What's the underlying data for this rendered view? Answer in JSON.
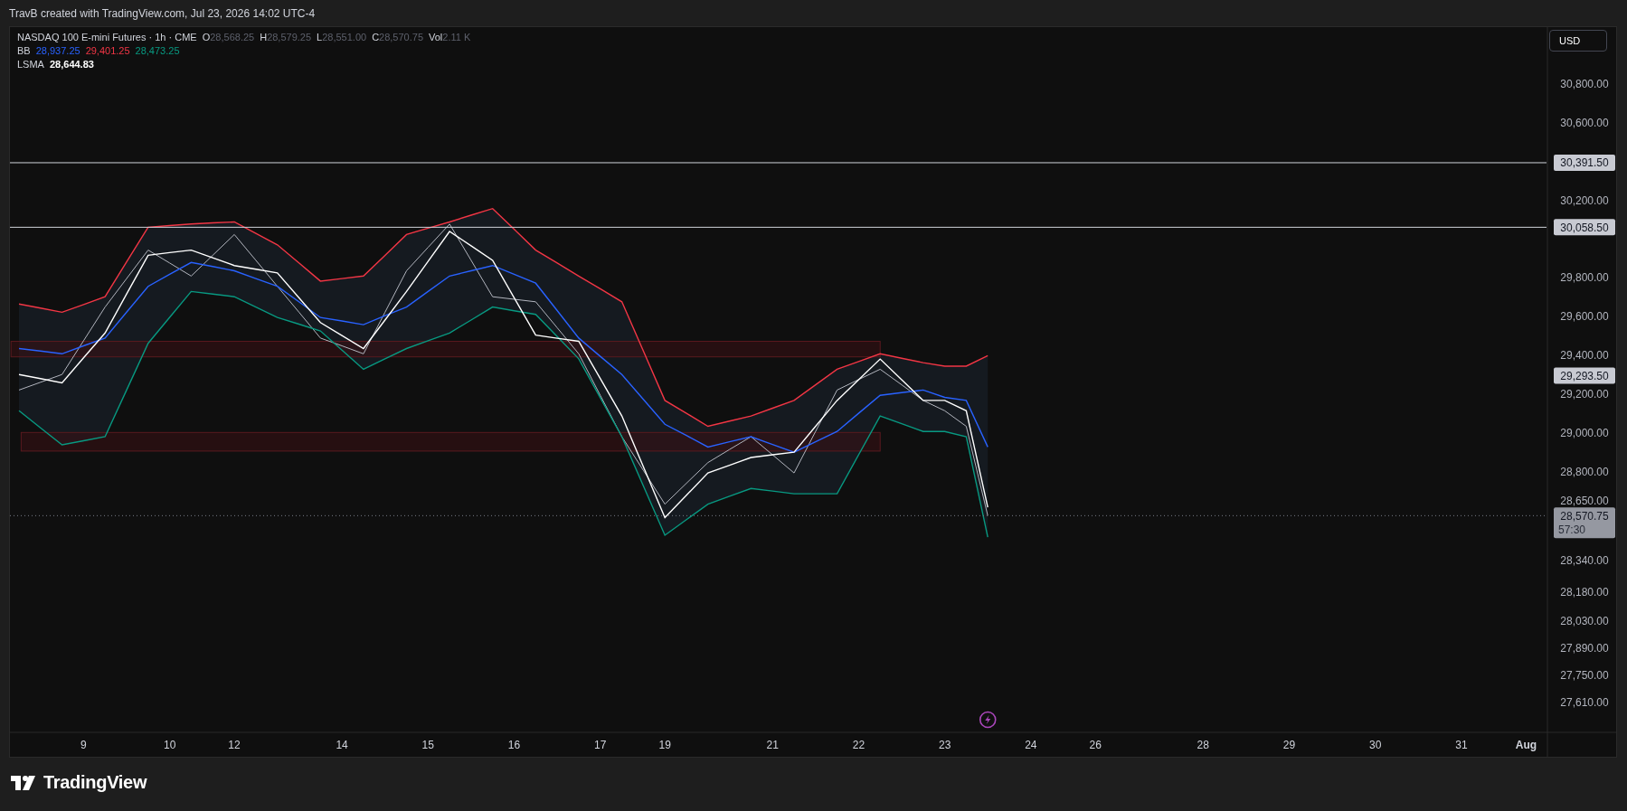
{
  "header": {
    "text": "TravB created with TradingView.com, Jul 23, 2026 14:02 UTC-4"
  },
  "chart": {
    "legend": {
      "symbol": "NASDAQ 100 E-mini Futures · 1h · CME",
      "ohlc": [
        {
          "label": "O",
          "value": "28,568.25"
        },
        {
          "label": "H",
          "value": "28,579.25"
        },
        {
          "label": "L",
          "value": "28,551.00"
        },
        {
          "label": "C",
          "value": "28,570.75"
        },
        {
          "label": "Vol",
          "value": "2.11 K"
        }
      ],
      "indicators": [
        {
          "label": "BB",
          "values": [
            {
              "text": "28,937.25",
              "color": "#2962ff"
            },
            {
              "text": "29,401.25",
              "color": "#f23645"
            },
            {
              "text": "28,473.25",
              "color": "#089981"
            }
          ]
        },
        {
          "label": "LSMA",
          "values": [
            {
              "text": "28,644.83",
              "color": "#ffffff"
            }
          ]
        }
      ]
    },
    "currency_button": "USD",
    "price_label": "29,293.50",
    "countdown": "57:30",
    "chart_data": {
      "type": "line",
      "categories": [
        null,
        null,
        null,
        "9",
        null,
        null,
        null,
        "10",
        null,
        null,
        "12",
        null,
        null,
        null,
        null,
        "14",
        null,
        null,
        null,
        "15",
        null,
        null,
        null,
        "16",
        null,
        null,
        null,
        "17",
        null,
        null,
        "19",
        null,
        null,
        null,
        null,
        "21",
        null,
        null,
        null,
        "22",
        null,
        null,
        null,
        "23",
        null,
        null,
        null,
        "24",
        null,
        null,
        "26",
        null,
        null,
        null,
        null,
        "28",
        null,
        null,
        null,
        "29",
        null,
        null,
        null,
        "30",
        null,
        null,
        null,
        "31",
        null,
        null,
        "Aug"
      ],
      "ylim": [
        27453,
        31091
      ],
      "yticks": [
        {
          "value": 30800,
          "label": "30,800.00"
        },
        {
          "value": 30600,
          "label": "30,600.00"
        },
        {
          "value": 30200,
          "label": "30,200.00"
        },
        {
          "value": 29800,
          "label": "29,800.00"
        },
        {
          "value": 29600,
          "label": "29,600.00"
        },
        {
          "value": 29400,
          "label": "29,400.00"
        },
        {
          "value": 29200,
          "label": "29,200.00"
        },
        {
          "value": 29000,
          "label": "29,000.00"
        },
        {
          "value": 28800,
          "label": "28,800.00"
        },
        {
          "value": 28650,
          "label": "28,650.00"
        },
        {
          "value": 28340,
          "label": "28,340.00"
        },
        {
          "value": 28180,
          "label": "28,180.00"
        },
        {
          "value": 28030,
          "label": "28,030.00"
        },
        {
          "value": 27890,
          "label": "27,890.00"
        },
        {
          "value": 27750,
          "label": "27,750.00"
        },
        {
          "value": 27610,
          "label": "27,610.00"
        }
      ],
      "series": [
        {
          "color": "#b2b5be",
          "values": [
            29219,
            29259,
            29299,
            29473,
            29647,
            29794,
            29941,
            29874,
            29807,
            29914,
            30021,
            29888,
            29754,
            29621,
            29487,
            29447,
            29406,
            29620,
            29834,
            29955,
            30075,
            29888,
            29700,
            29687,
            29674,
            29540,
            29406,
            29192,
            28978,
            28804,
            28630,
            28738,
            28845,
            28912,
            28978,
            28885,
            28791,
            29005,
            29219,
            29273,
            29326,
            29246,
            29165,
            29112,
            29032,
            28571,
            null,
            null,
            null,
            null,
            null,
            null,
            null,
            null,
            null,
            null,
            null,
            null,
            null,
            null,
            null,
            null,
            null,
            null,
            null,
            null,
            null,
            null,
            null,
            null,
            null
          ]
        },
        {
          "color": "#f23645",
          "values": [
            29663,
            29642,
            29620,
            29660,
            29700,
            29880,
            30059,
            30067,
            30075,
            30081,
            30086,
            30027,
            29968,
            29875,
            29781,
            29794,
            29807,
            29914,
            30021,
            30054,
            30086,
            30121,
            30155,
            30048,
            29941,
            29874,
            29807,
            29741,
            29674,
            29420,
            29165,
            29099,
            29032,
            29059,
            29085,
            29125,
            29165,
            29246,
            29326,
            29366,
            29406,
            29383,
            29360,
            29342,
            29342,
            29396,
            null,
            null,
            null,
            null,
            null,
            null,
            null,
            null,
            null,
            null,
            null,
            null,
            null,
            null,
            null,
            null,
            null,
            null,
            null,
            null,
            null,
            null,
            null,
            null,
            null
          ]
        },
        {
          "color": "#2962ff",
          "values": [
            29433,
            29420,
            29406,
            29447,
            29487,
            29621,
            29754,
            29816,
            29877,
            29856,
            29834,
            29794,
            29754,
            29674,
            29593,
            29575,
            29556,
            29602,
            29647,
            29727,
            29807,
            29834,
            29861,
            29816,
            29770,
            29629,
            29487,
            29393,
            29299,
            29171,
            29042,
            28984,
            28925,
            28952,
            28978,
            28938,
            28898,
            28952,
            29005,
            29099,
            29192,
            29206,
            29219,
            29181,
            29165,
            28925,
            null,
            null,
            null,
            null,
            null,
            null,
            null,
            null,
            null,
            null,
            null,
            null,
            null,
            null,
            null,
            null,
            null,
            null,
            null,
            null,
            null,
            null,
            null,
            null,
            null
          ]
        },
        {
          "color": "#089981",
          "values": [
            29112,
            29024,
            28936,
            28957,
            28978,
            29219,
            29460,
            29594,
            29727,
            29714,
            29700,
            29647,
            29593,
            29559,
            29524,
            29425,
            29326,
            29380,
            29433,
            29473,
            29513,
            29580,
            29647,
            29628,
            29609,
            29495,
            29380,
            29179,
            28978,
            28724,
            28470,
            28550,
            28630,
            28671,
            28711,
            28698,
            28684,
            28684,
            28684,
            28885,
            29085,
            29045,
            29005,
            29005,
            28978,
            28460,
            null,
            null,
            null,
            null,
            null,
            null,
            null,
            null,
            null,
            null,
            null,
            null,
            null,
            null,
            null,
            null,
            null,
            null,
            null,
            null,
            null,
            null,
            null,
            null,
            null
          ]
        },
        {
          "color": "#ffffff",
          "values": [
            29299,
            29278,
            29256,
            29385,
            29513,
            29714,
            29914,
            29928,
            29941,
            29901,
            29861,
            29842,
            29823,
            29695,
            29567,
            29500,
            29433,
            29580,
            29727,
            29882,
            30037,
            29963,
            29888,
            29695,
            29502,
            29486,
            29470,
            29278,
            29085,
            28823,
            28561,
            28676,
            28791,
            28831,
            28871,
            28885,
            28898,
            29032,
            29165,
            29272,
            29379,
            29272,
            29165,
            29165,
            29112,
            28614,
            null,
            null,
            null,
            null,
            null,
            null,
            null,
            null,
            null,
            null,
            null,
            null,
            null,
            null,
            null,
            null,
            null,
            null,
            null,
            null,
            null,
            null,
            null,
            null,
            null
          ]
        }
      ],
      "ref_lines": [
        {
          "axis": "y",
          "value": 30391.5,
          "label": "30,391.50"
        },
        {
          "axis": "y",
          "value": 30058.5,
          "label": "30,058.50"
        },
        {
          "axis": "y",
          "value": 28570.75,
          "label": "28,570.75"
        }
      ]
    }
  },
  "footer": {
    "logo": "TradingView"
  }
}
